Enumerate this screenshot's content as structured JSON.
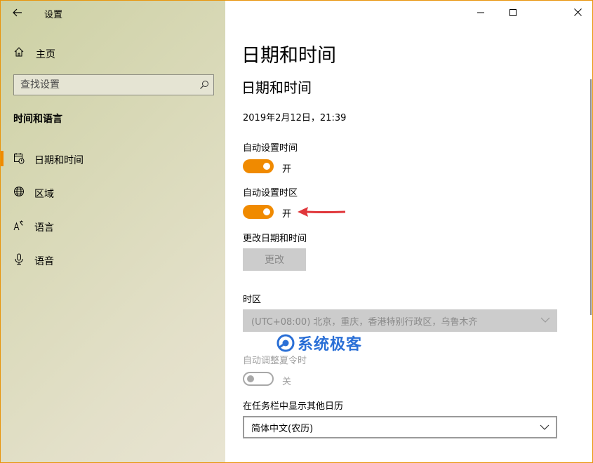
{
  "window": {
    "app_title": "设置",
    "controls": [
      "minimize",
      "maximize",
      "close"
    ]
  },
  "sidebar": {
    "home_label": "主页",
    "search_placeholder": "查找设置",
    "section_title": "时间和语言",
    "items": [
      {
        "label": "日期和时间",
        "icon": "calendar-clock-icon",
        "active": true
      },
      {
        "label": "区域",
        "icon": "globe-icon",
        "active": false
      },
      {
        "label": "语言",
        "icon": "language-icon",
        "active": false
      },
      {
        "label": "语音",
        "icon": "microphone-icon",
        "active": false
      }
    ]
  },
  "main": {
    "page_title": "日期和时间",
    "section_title": "日期和时间",
    "current_datetime": "2019年2月12日，21:39",
    "auto_time": {
      "label": "自动设置时间",
      "state": "开",
      "on": true
    },
    "auto_timezone": {
      "label": "自动设置时区",
      "state": "开",
      "on": true
    },
    "change_datetime": {
      "label": "更改日期和时间",
      "button": "更改"
    },
    "timezone": {
      "label": "时区",
      "value": "(UTC+08:00) 北京，重庆，香港特别行政区，乌鲁木齐"
    },
    "dst": {
      "label": "自动调整夏令时",
      "state": "关",
      "on": false
    },
    "calendar": {
      "label": "在任务栏中显示其他日历",
      "value": "简体中文(农历)"
    }
  },
  "watermark": {
    "text": "系统极客"
  },
  "colors": {
    "accent": "#f08a00",
    "annotation_arrow": "#e0363a",
    "watermark": "#2a6fd6",
    "window_border": "#e8950c"
  }
}
